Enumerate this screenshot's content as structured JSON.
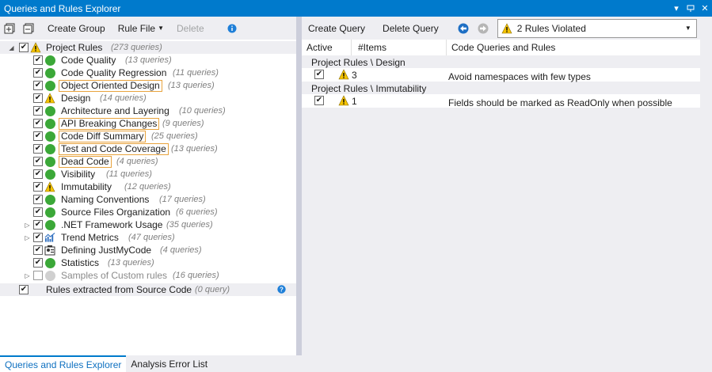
{
  "window": {
    "title": "Queries and Rules Explorer"
  },
  "left_toolbar": {
    "create_group": "Create Group",
    "rule_file": "Rule File",
    "delete": "Delete"
  },
  "tree": {
    "root": {
      "label": "Project Rules",
      "count": "(273 queries)"
    },
    "groups": [
      {
        "label": "Code Quality",
        "count": "(13 queries)",
        "status": "green"
      },
      {
        "label": "Code Quality Regression",
        "count": "(11 queries)",
        "status": "green"
      },
      {
        "label": "Object Oriented Design",
        "count": "(13 queries)",
        "status": "green",
        "boxed": true
      },
      {
        "label": "Design",
        "count": "(14 queries)",
        "status": "warning"
      },
      {
        "label": "Architecture and Layering",
        "count": "(10 queries)",
        "status": "green"
      },
      {
        "label": "API Breaking Changes",
        "count": "(9 queries)",
        "status": "green",
        "boxed": true
      },
      {
        "label": "Code Diff Summary",
        "count": "(25 queries)",
        "status": "green",
        "boxed": true
      },
      {
        "label": "Test and Code Coverage",
        "count": "(13 queries)",
        "status": "green",
        "boxed": true
      },
      {
        "label": "Dead Code",
        "count": "(4 queries)",
        "status": "green",
        "boxed": true
      },
      {
        "label": "Visibility",
        "count": "(11 queries)",
        "status": "green"
      },
      {
        "label": "Immutability",
        "count": "(12 queries)",
        "status": "warning"
      },
      {
        "label": "Naming Conventions",
        "count": "(17 queries)",
        "status": "green"
      },
      {
        "label": "Source Files Organization",
        "count": "(6 queries)",
        "status": "green"
      },
      {
        "label": ".NET Framework Usage",
        "count": "(35 queries)",
        "status": "green",
        "expandable": true
      },
      {
        "label": "Trend Metrics",
        "count": "(47 queries)",
        "status": "trend",
        "expandable": true
      },
      {
        "label": "Defining JustMyCode",
        "count": "(4 queries)",
        "status": "jmc"
      },
      {
        "label": "Statistics",
        "count": "(13 queries)",
        "status": "green"
      },
      {
        "label": "Samples of Custom rules",
        "count": "(16 queries)",
        "status": "gray",
        "unchecked": true,
        "expandable": true
      }
    ],
    "source_rules": {
      "label": "Rules extracted from Source Code",
      "count": "(0 query)"
    }
  },
  "right_toolbar": {
    "create_query": "Create Query",
    "delete_query": "Delete Query",
    "dropdown_value": "2 Rules Violated"
  },
  "grid": {
    "columns": [
      "Active",
      "#Items",
      "Code Queries and Rules"
    ],
    "groups": [
      {
        "header": "Project Rules \\ Design",
        "items": "3",
        "rule": "Avoid namespaces with few types"
      },
      {
        "header": "Project Rules \\ Immutability",
        "items": "1",
        "rule": "Fields should be marked as ReadOnly when possible"
      }
    ]
  },
  "bottom_tabs": [
    "Queries and Rules Explorer",
    "Analysis Error List"
  ],
  "colors": {
    "accent": "#007acc",
    "ok": "#3ba838",
    "warning": "#f5c400",
    "highlight_box": "#e8a33d"
  }
}
